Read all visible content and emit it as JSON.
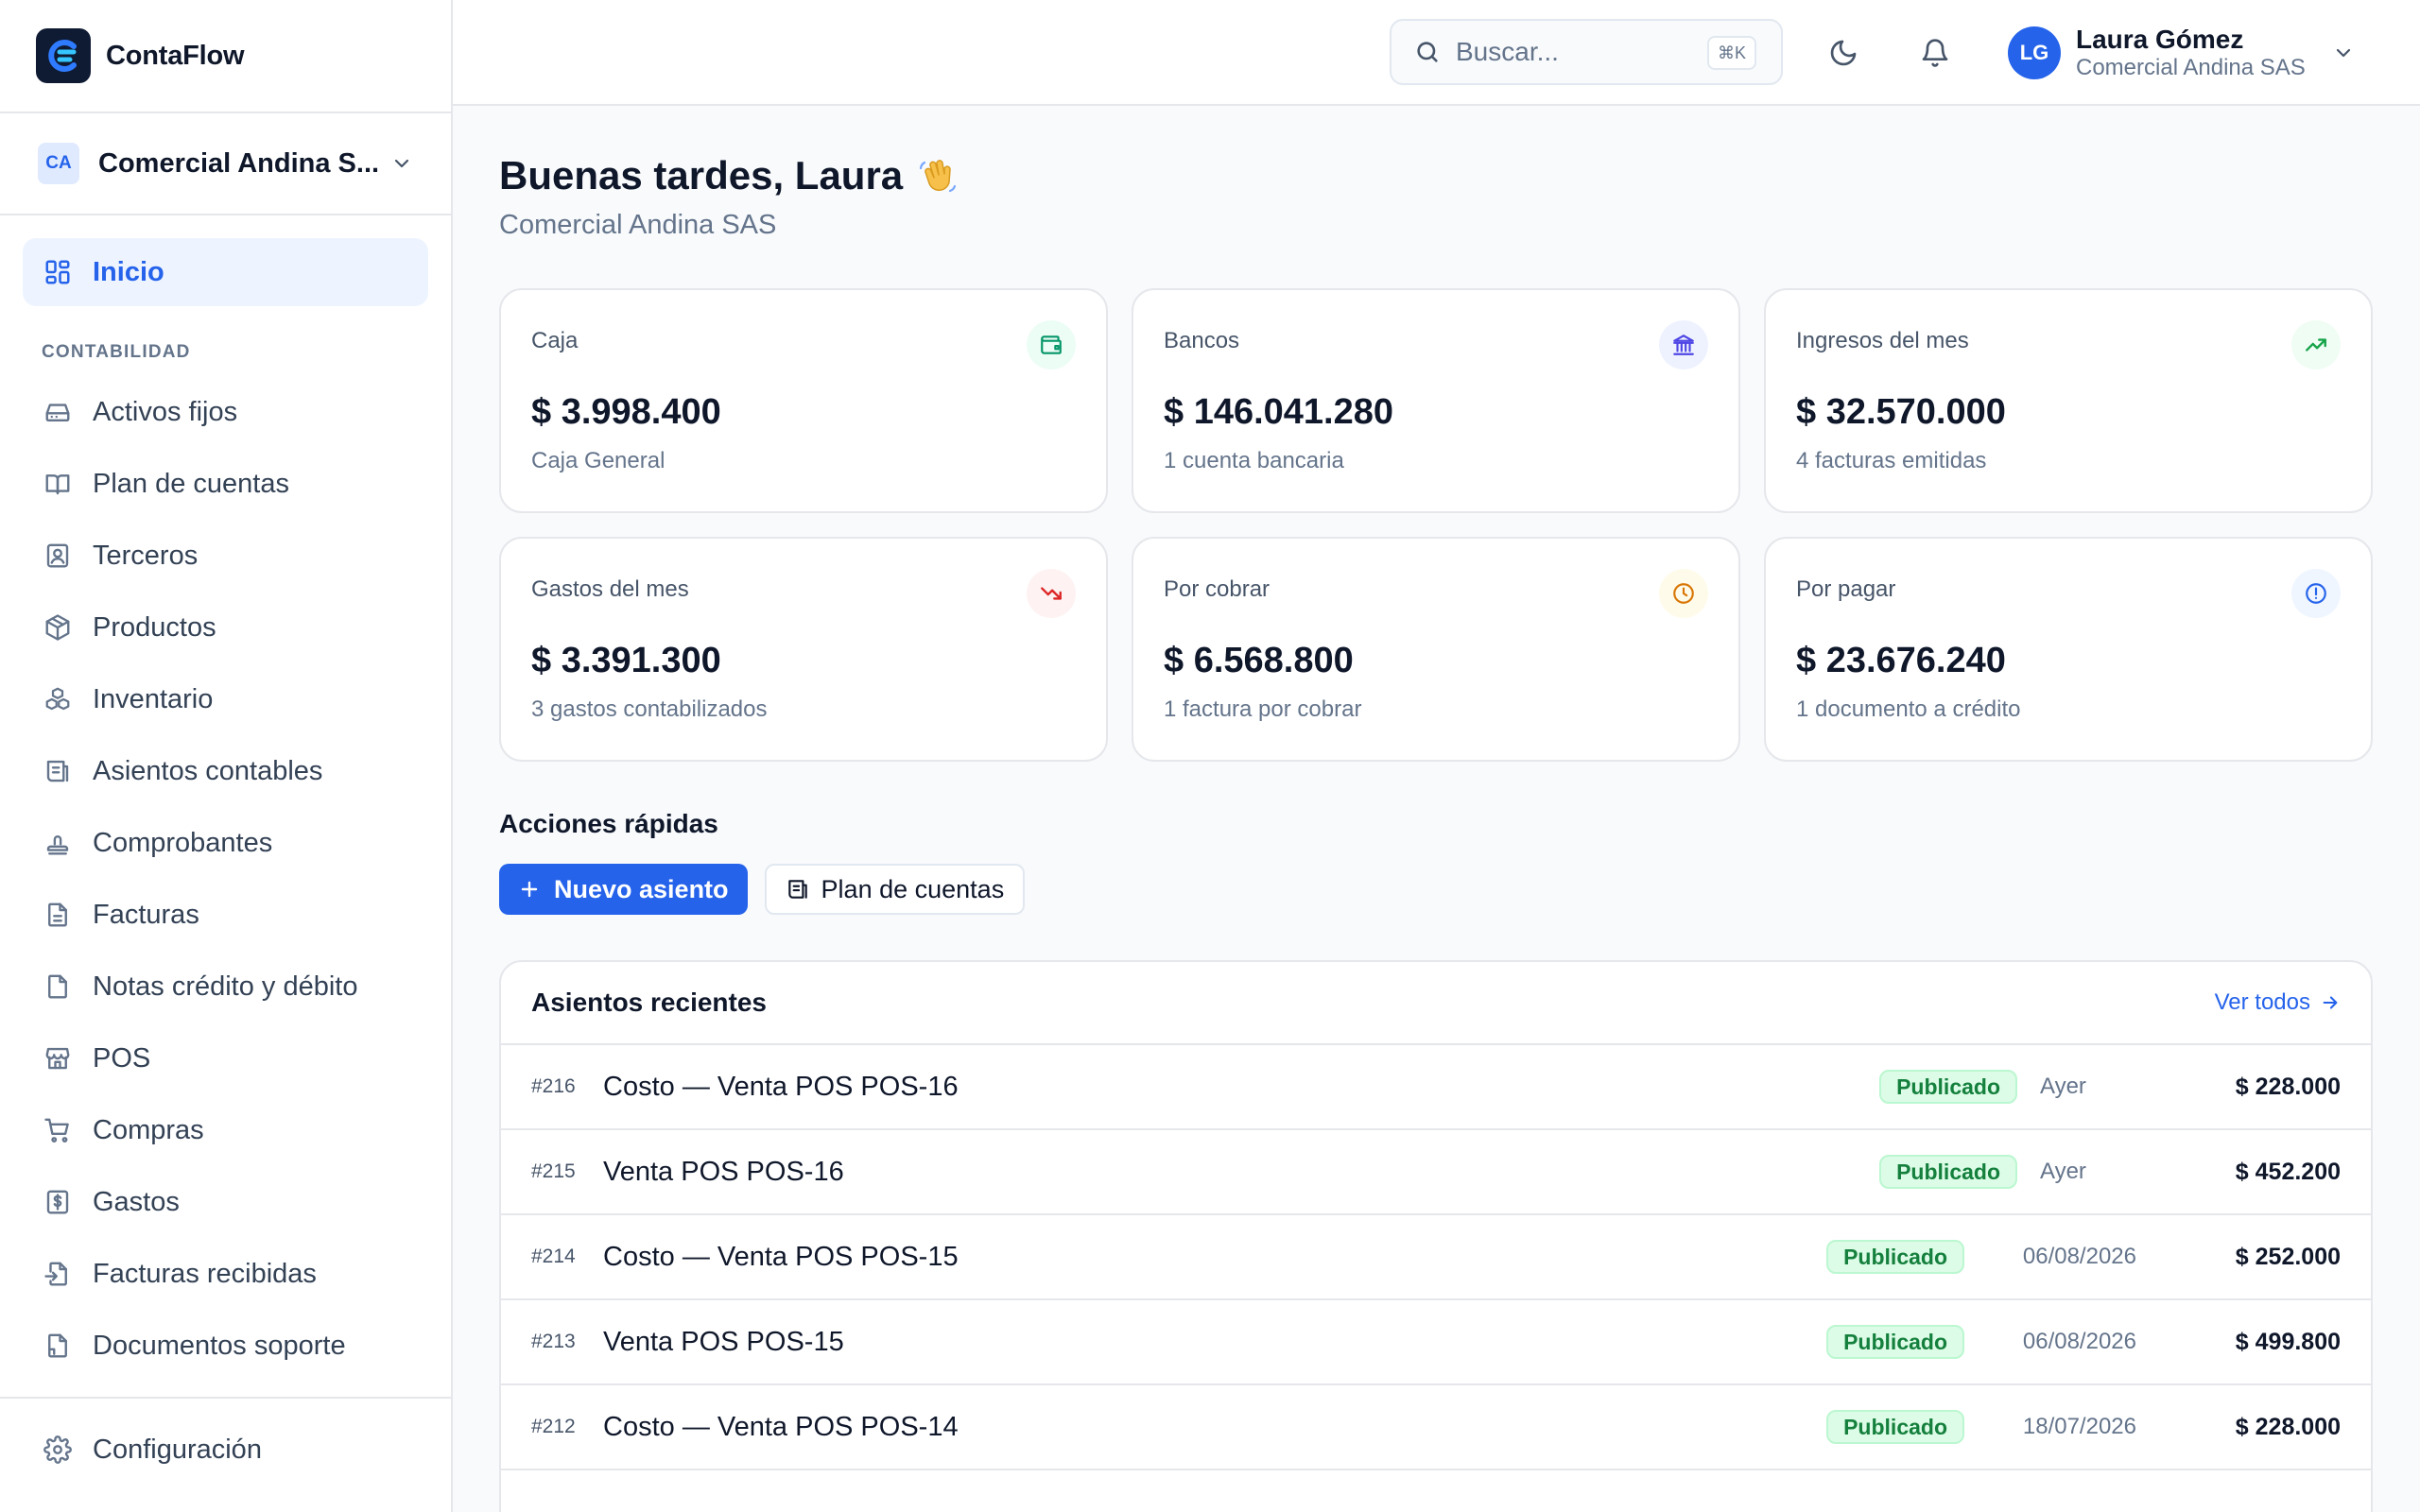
{
  "app": {
    "name": "ContaFlow"
  },
  "company": {
    "initials": "CA",
    "name": "Comercial Andina S..."
  },
  "nav": {
    "home": "Inicio",
    "section": "CONTABILIDAD",
    "items": [
      {
        "label": "Activos fijos",
        "icon": "hard-drive-icon"
      },
      {
        "label": "Plan de cuentas",
        "icon": "book-open-icon"
      },
      {
        "label": "Terceros",
        "icon": "contact-icon"
      },
      {
        "label": "Productos",
        "icon": "package-icon"
      },
      {
        "label": "Inventario",
        "icon": "boxes-icon"
      },
      {
        "label": "Asientos contables",
        "icon": "ledger-icon"
      },
      {
        "label": "Comprobantes",
        "icon": "stamp-icon"
      },
      {
        "label": "Facturas",
        "icon": "file-text-icon"
      },
      {
        "label": "Notas crédito y débito",
        "icon": "file-icon"
      },
      {
        "label": "POS",
        "icon": "store-icon"
      },
      {
        "label": "Compras",
        "icon": "cart-icon"
      },
      {
        "label": "Gastos",
        "icon": "receipt-dollar-icon"
      },
      {
        "label": "Facturas recibidas",
        "icon": "file-input-icon"
      },
      {
        "label": "Documentos soporte",
        "icon": "file-badge-icon"
      }
    ],
    "settings": "Configuración"
  },
  "topbar": {
    "search_placeholder": "Buscar...",
    "search_shortcut": "⌘K",
    "user": {
      "initials": "LG",
      "name": "Laura Gómez",
      "company": "Comercial Andina SAS"
    }
  },
  "greeting": {
    "title": "Buenas tardes, Laura",
    "emoji": "👋",
    "subtitle": "Comercial Andina SAS"
  },
  "kpis": [
    {
      "label": "Caja",
      "value": "$ 3.998.400",
      "sub": "Caja General",
      "icon": "wallet-icon",
      "color": "#059669",
      "bg": "#ecfdf5"
    },
    {
      "label": "Bancos",
      "value": "$ 146.041.280",
      "sub": "1 cuenta bancaria",
      "icon": "bank-icon",
      "color": "#4f46e5",
      "bg": "#eef2ff"
    },
    {
      "label": "Ingresos del mes",
      "value": "$ 32.570.000",
      "sub": "4 facturas emitidas",
      "icon": "trending-up-icon",
      "color": "#16a34a",
      "bg": "#f0fdf4"
    },
    {
      "label": "Gastos del mes",
      "value": "$ 3.391.300",
      "sub": "3 gastos contabilizados",
      "icon": "trending-down-icon",
      "color": "#dc2626",
      "bg": "#fef2f2"
    },
    {
      "label": "Por cobrar",
      "value": "$ 6.568.800",
      "sub": "1 factura por cobrar",
      "icon": "clock-icon",
      "color": "#d97706",
      "bg": "#fffbeb"
    },
    {
      "label": "Por pagar",
      "value": "$ 23.676.240",
      "sub": "1 documento a crédito",
      "icon": "alert-circle-icon",
      "color": "#2563eb",
      "bg": "#eff6ff"
    }
  ],
  "quick_actions": {
    "title": "Acciones rápidas",
    "primary": "Nuevo asiento",
    "secondary": "Plan de cuentas"
  },
  "recent": {
    "title": "Asientos recientes",
    "see_all": "Ver todos",
    "rows": [
      {
        "num": "#216",
        "desc": "Costo — Venta POS POS-16",
        "status": "Publicado",
        "date": "Ayer",
        "amount": "$ 228.000"
      },
      {
        "num": "#215",
        "desc": "Venta POS POS-16",
        "status": "Publicado",
        "date": "Ayer",
        "amount": "$ 452.200"
      },
      {
        "num": "#214",
        "desc": "Costo — Venta POS POS-15",
        "status": "Publicado",
        "date": "06/08/2026",
        "amount": "$ 252.000"
      },
      {
        "num": "#213",
        "desc": "Venta POS POS-15",
        "status": "Publicado",
        "date": "06/08/2026",
        "amount": "$ 499.800"
      },
      {
        "num": "#212",
        "desc": "Costo — Venta POS POS-14",
        "status": "Publicado",
        "date": "18/07/2026",
        "amount": "$ 228.000"
      }
    ]
  },
  "colors": {
    "accent": "#2563eb",
    "success": "#15803d",
    "border": "#e5e7eb"
  }
}
